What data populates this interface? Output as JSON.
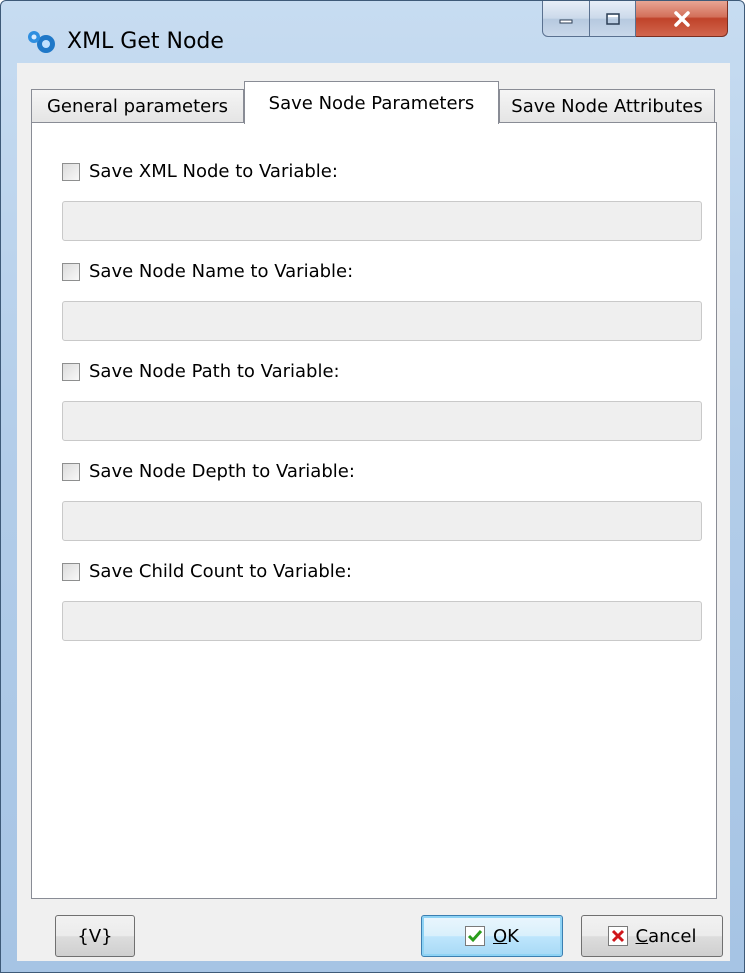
{
  "window": {
    "title": "XML Get Node",
    "icon": "gears-app-icon",
    "controls": [
      "minimize",
      "maximize",
      "close"
    ]
  },
  "tabs": [
    {
      "label": "General parameters",
      "active": false
    },
    {
      "label": "Save Node Parameters",
      "active": true
    },
    {
      "label": "Save Node Attributes",
      "active": false
    }
  ],
  "options": [
    {
      "label": "Save XML Node to Variable:",
      "checked": false,
      "value": ""
    },
    {
      "label": "Save Node Name to Variable:",
      "checked": false,
      "value": ""
    },
    {
      "label": "Save Node Path to Variable:",
      "checked": false,
      "value": ""
    },
    {
      "label": "Save Node Depth to Variable:",
      "checked": false,
      "value": ""
    },
    {
      "label": "Save Child Count to Variable:",
      "checked": false,
      "value": ""
    }
  ],
  "buttons": {
    "variables": "{V}",
    "ok_accel": "O",
    "ok_rest": "K",
    "cancel_accel": "C",
    "cancel_rest": "ancel"
  },
  "colors": {
    "ok_check": "#2a9d1a",
    "cancel_x": "#d0161b",
    "active_tab_bg": "#ffffff"
  }
}
